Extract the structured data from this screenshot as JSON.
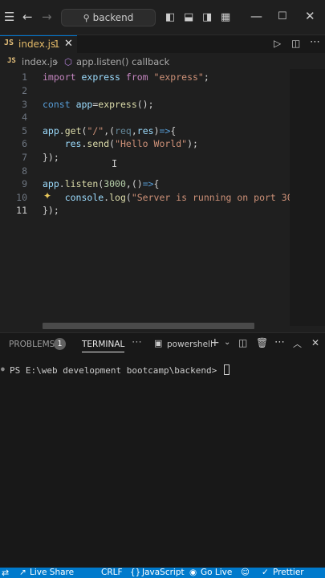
{
  "window": {
    "search_text": "backend"
  },
  "tabs": [
    {
      "badge": "JS",
      "name": "index.js",
      "problems": "1",
      "close": "✕"
    }
  ],
  "breadcrumb": {
    "file": "index.js",
    "separator": "›",
    "symbol": "app.listen() callback"
  },
  "editor": {
    "line_numbers": [
      "1",
      "2",
      "3",
      "4",
      "5",
      "6",
      "7",
      "8",
      "9",
      "10",
      "11"
    ]
  },
  "panel": {
    "problems_label": "PROBLEMS",
    "problems_count": "1",
    "terminal_label": "TERMINAL",
    "shell_label": "powershell",
    "prompt": "PS E:\\web development bootcamp\\backend> "
  },
  "status_bar": {
    "live_share": "Live Share",
    "eol": "CRLF",
    "language": "JavaScript",
    "go_live": "Go Live",
    "prettier": "Prettier"
  },
  "colors": {
    "accent": "#007acc",
    "tab_modified": "#e2b968",
    "editor_bg": "#1f1f1f"
  }
}
